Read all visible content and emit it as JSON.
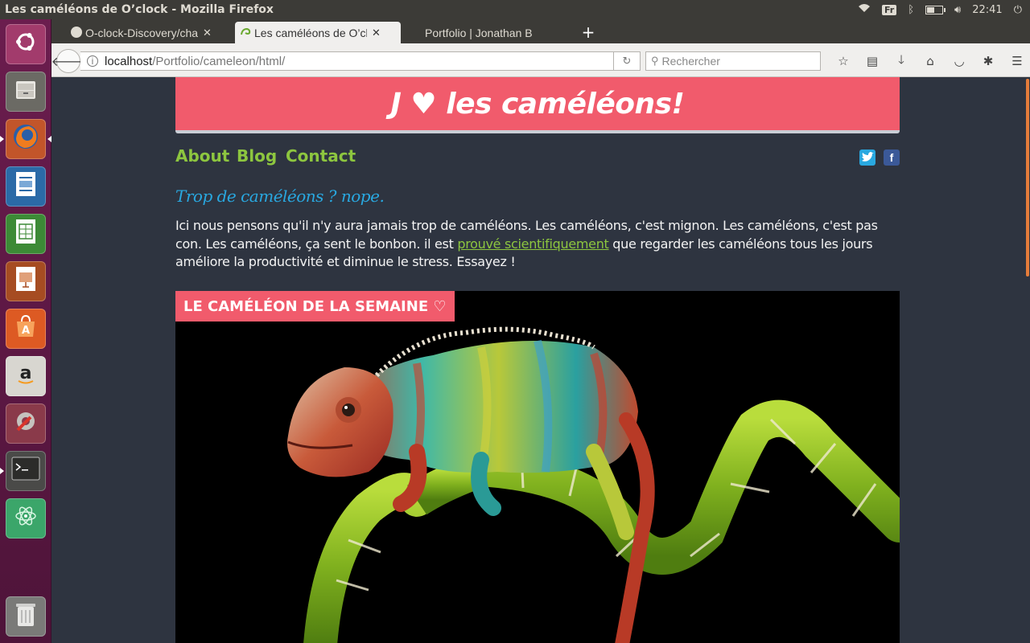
{
  "system": {
    "window_title": "Les caméléons de O’clock - Mozilla Firefox",
    "keyboard_layout": "Fr",
    "clock": "22:41",
    "battery_level": 0.55,
    "indicators": [
      "wifi-icon",
      "bluetooth-icon",
      "battery-icon",
      "volume-icon",
      "power-icon"
    ]
  },
  "launcher": {
    "items": [
      {
        "name": "ubuntu-dash",
        "icon": "ubuntu-logo-icon",
        "bg": "#a23b6c"
      },
      {
        "name": "files",
        "icon": "file-cabinet-icon",
        "bg": "#6b6a64"
      },
      {
        "name": "firefox",
        "icon": "firefox-icon",
        "bg": "#c2552a"
      },
      {
        "name": "writer",
        "icon": "document-icon",
        "bg": "#2b6aa7"
      },
      {
        "name": "calc",
        "icon": "spreadsheet-icon",
        "bg": "#3c8a36"
      },
      {
        "name": "impress",
        "icon": "presentation-icon",
        "bg": "#a64c22"
      },
      {
        "name": "software-center",
        "icon": "shopping-bag-icon",
        "bg": "#dd5a23"
      },
      {
        "name": "amazon",
        "icon": "amazon-icon",
        "bg": "#d8d6d0"
      },
      {
        "name": "system-settings",
        "icon": "wrench-icon",
        "bg": "#8a3a4a"
      },
      {
        "name": "terminal",
        "icon": "terminal-icon",
        "bg": "#4a4a48"
      },
      {
        "name": "atom",
        "icon": "atom-icon",
        "bg": "#3ba66a"
      },
      {
        "name": "trash",
        "icon": "trash-icon",
        "bg": "#7a7a78"
      }
    ]
  },
  "browser": {
    "tabs": [
      {
        "label": "O-clock-Discovery/cha",
        "icon": "github-icon",
        "active": false
      },
      {
        "label": "Les caméléons de O’clo",
        "icon": "chameleon-icon",
        "active": true
      },
      {
        "label": "Portfolio | Jonathan B",
        "icon": "",
        "active": false
      }
    ],
    "new_tab_label": "+",
    "url_host": "localhost",
    "url_path": "/Portfolio/cameleon/html/",
    "search_placeholder": "Rechercher",
    "toolbar_icons": [
      "star-icon",
      "reading-list-icon",
      "download-icon",
      "home-icon",
      "pocket-icon",
      "extension-icon",
      "menu-icon"
    ]
  },
  "page": {
    "banner_title": "J ♥ les caméléons!",
    "nav": [
      "About",
      "Blog",
      "Contact"
    ],
    "social": [
      "twitter",
      "facebook"
    ],
    "tagline": "Trop de caméléons ? nope.",
    "intro_before": "Ici nous pensons qu'il n'y aura jamais trop de caméléons. Les caméléons, c'est mignon. Les caméléons, c'est pas con. Les caméléons, ça sent le bonbon. il est ",
    "intro_link": "prouvé scientifiquement",
    "intro_after": " que regarder les caméléons tous les jours améliore la productivité et diminue le stress. Essayez !",
    "feature_label": "LE CAMÉLÉON DE LA SEMAINE ♡",
    "colors": {
      "background": "#2e3440",
      "accent_pink": "#f15b6c",
      "accent_green": "#8dc63f",
      "tagline_blue": "#29a8e0"
    }
  }
}
